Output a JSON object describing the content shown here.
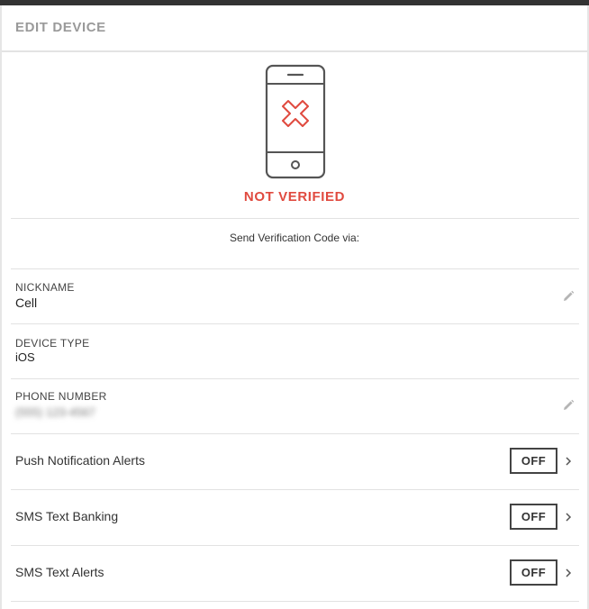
{
  "header": {
    "title": "EDIT DEVICE"
  },
  "status": {
    "label": "NOT VERIFIED",
    "color": "#e04a3f",
    "icon": "phone-not-verified-icon"
  },
  "verification": {
    "send_text": "Send Verification Code via:"
  },
  "fields": {
    "nickname": {
      "label": "NICKNAME",
      "value": "Cell"
    },
    "device_type": {
      "label": "DEVICE TYPE",
      "value": "iOS"
    },
    "phone_number": {
      "label": "PHONE NUMBER",
      "value": "(555) 123-4567"
    }
  },
  "alerts": [
    {
      "label": "Push Notification Alerts",
      "state": "OFF"
    },
    {
      "label": "SMS Text Banking",
      "state": "OFF"
    },
    {
      "label": "SMS Text Alerts",
      "state": "OFF"
    }
  ],
  "colors": {
    "accent": "#e04a3f",
    "text": "#333333",
    "muted": "#9a9a9a",
    "divider": "#e2e2e2"
  }
}
